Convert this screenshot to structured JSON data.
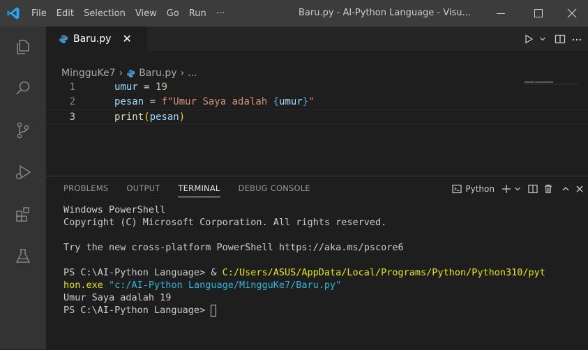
{
  "titlebar": {
    "menu": [
      "File",
      "Edit",
      "Selection",
      "View",
      "Go",
      "Run",
      "···"
    ],
    "title": "Baru.py - AI-Python Language - Visu..."
  },
  "tab": {
    "label": "Baru.py",
    "close": "✕"
  },
  "breadcrumb": {
    "folder": "MingguKe7",
    "file": "Baru.py",
    "more": "..."
  },
  "code_lines": [
    {
      "num": "1",
      "tokens": [
        {
          "t": "umur",
          "c": "var"
        },
        {
          "t": " = ",
          "c": "op"
        },
        {
          "t": "19",
          "c": "num"
        }
      ]
    },
    {
      "num": "2",
      "tokens": [
        {
          "t": "pesan",
          "c": "var"
        },
        {
          "t": " = ",
          "c": "op"
        },
        {
          "t": "f\"Umur Saya adalah ",
          "c": "str"
        },
        {
          "t": "{",
          "c": "brace"
        },
        {
          "t": "umur",
          "c": "var"
        },
        {
          "t": "}",
          "c": "brace"
        },
        {
          "t": "\"",
          "c": "str"
        }
      ]
    },
    {
      "num": "3",
      "tokens": [
        {
          "t": "print",
          "c": "fn"
        },
        {
          "t": "(",
          "c": "paren"
        },
        {
          "t": "pesan",
          "c": "var"
        },
        {
          "t": ")",
          "c": "paren"
        }
      ]
    }
  ],
  "panel": {
    "tabs": [
      "PROBLEMS",
      "OUTPUT",
      "TERMINAL",
      "DEBUG CONSOLE"
    ],
    "active_tab": "TERMINAL",
    "terminal_name": "Python"
  },
  "terminal": {
    "line1": "Windows PowerShell",
    "line2": "Copyright (C) Microsoft Corporation. All rights reserved.",
    "line3": "Try the new cross-platform PowerShell https://aka.ms/pscore6",
    "cmd_prompt": "PS C:\\AI-Python Language> & ",
    "cmd_exe_a": "C:/Users/ASUS/AppData/Local/Programs/Python/Python310/pyt",
    "cmd_exe_b": "hon.exe",
    "cmd_arg": " \"c:/AI-Python Language/MingguKe7/Baru.py\"",
    "output": "Umur Saya adalah 19",
    "prompt": "PS C:\\AI-Python Language> "
  },
  "colors": {
    "titlebar": "#3c3c3c",
    "activitybar": "#333333",
    "editor_bg": "#1e1e1e",
    "accent_blue": "#007acc"
  }
}
